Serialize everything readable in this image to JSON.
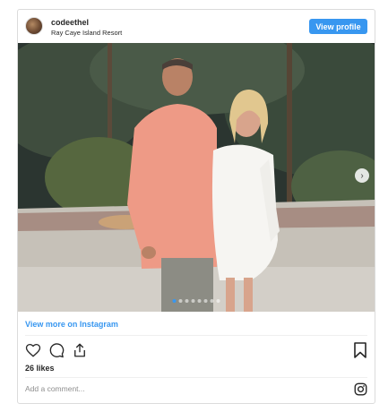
{
  "post": {
    "username": "codeethel",
    "location": "Ray Caye Island Resort",
    "view_profile_label": "View profile",
    "view_more_label": "View more on Instagram",
    "likes": "26 likes",
    "comment_placeholder": "Add a comment...",
    "carousel": {
      "total_slides": 8,
      "active_slide": 1
    }
  },
  "icons": {
    "avatar": "profile-photo",
    "like": "heart-icon",
    "comment": "comment-bubble-icon",
    "share": "share-icon",
    "save": "bookmark-icon",
    "next": "chevron-right-icon",
    "brand": "instagram-icon"
  },
  "colors": {
    "accent": "#3897f0",
    "border": "#dbdbdb",
    "text": "#262626",
    "muted": "#8e8e8e"
  }
}
